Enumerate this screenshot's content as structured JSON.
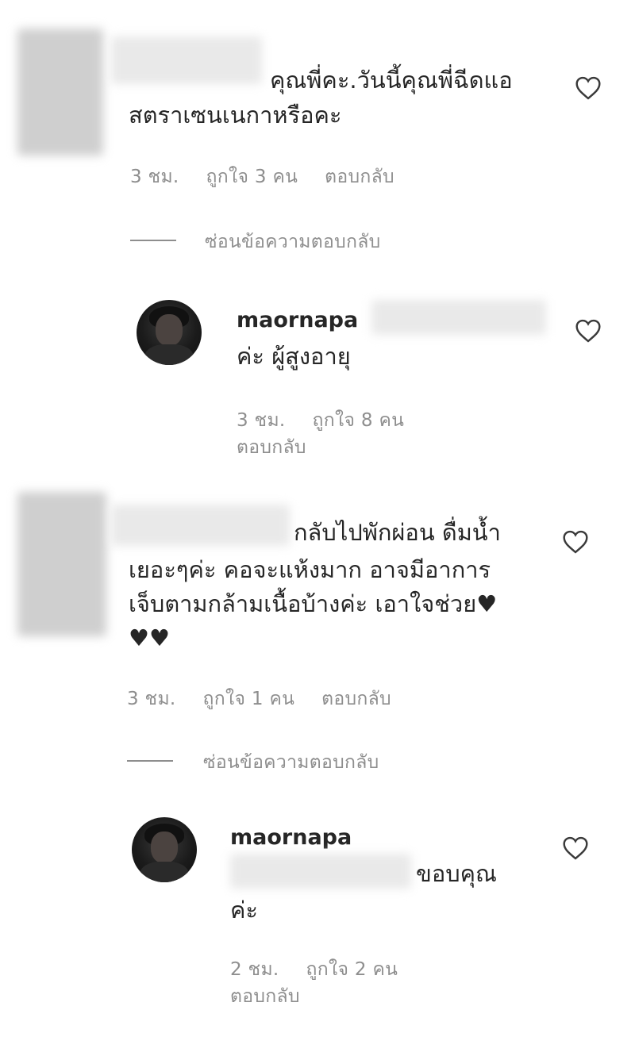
{
  "comments": [
    {
      "text_line1": "คุณพี่คะ.วันนี้คุณพี่ฉีดแอ",
      "text_line2": "สตราเซนเนกาหรือคะ",
      "time": "3 ชม.",
      "likes": "ถูกใจ 3 คน",
      "reply": "ตอบกลับ",
      "hide_replies": "ซ่อนข้อความตอบกลับ",
      "replies": [
        {
          "username": "maornapa",
          "text": "ค่ะ ผู้สูงอายุ",
          "time": "3 ชม.",
          "likes": "ถูกใจ 8 คน",
          "reply": "ตอบกลับ"
        }
      ]
    },
    {
      "text_line1": "กลับไปพักผ่อน ดื่มน้ำ",
      "text_line2": "เยอะๆค่ะ คอจะแห้งมาก อาจมีอาการ",
      "text_line3": "เจ็บตามกล้ามเนื้อบ้างค่ะ เอาใจช่วย♥",
      "text_line4": "♥♥",
      "time": "3 ชม.",
      "likes": "ถูกใจ 1 คน",
      "reply": "ตอบกลับ",
      "hide_replies": "ซ่อนข้อความตอบกลับ",
      "replies": [
        {
          "username": "maornapa",
          "text_line1": "ขอบคุณ",
          "text_line2": "ค่ะ",
          "time": "2 ชม.",
          "likes": "ถูกใจ 2 คน",
          "reply": "ตอบกลับ"
        }
      ]
    }
  ],
  "icons": {
    "like": "heart-outline-icon"
  }
}
